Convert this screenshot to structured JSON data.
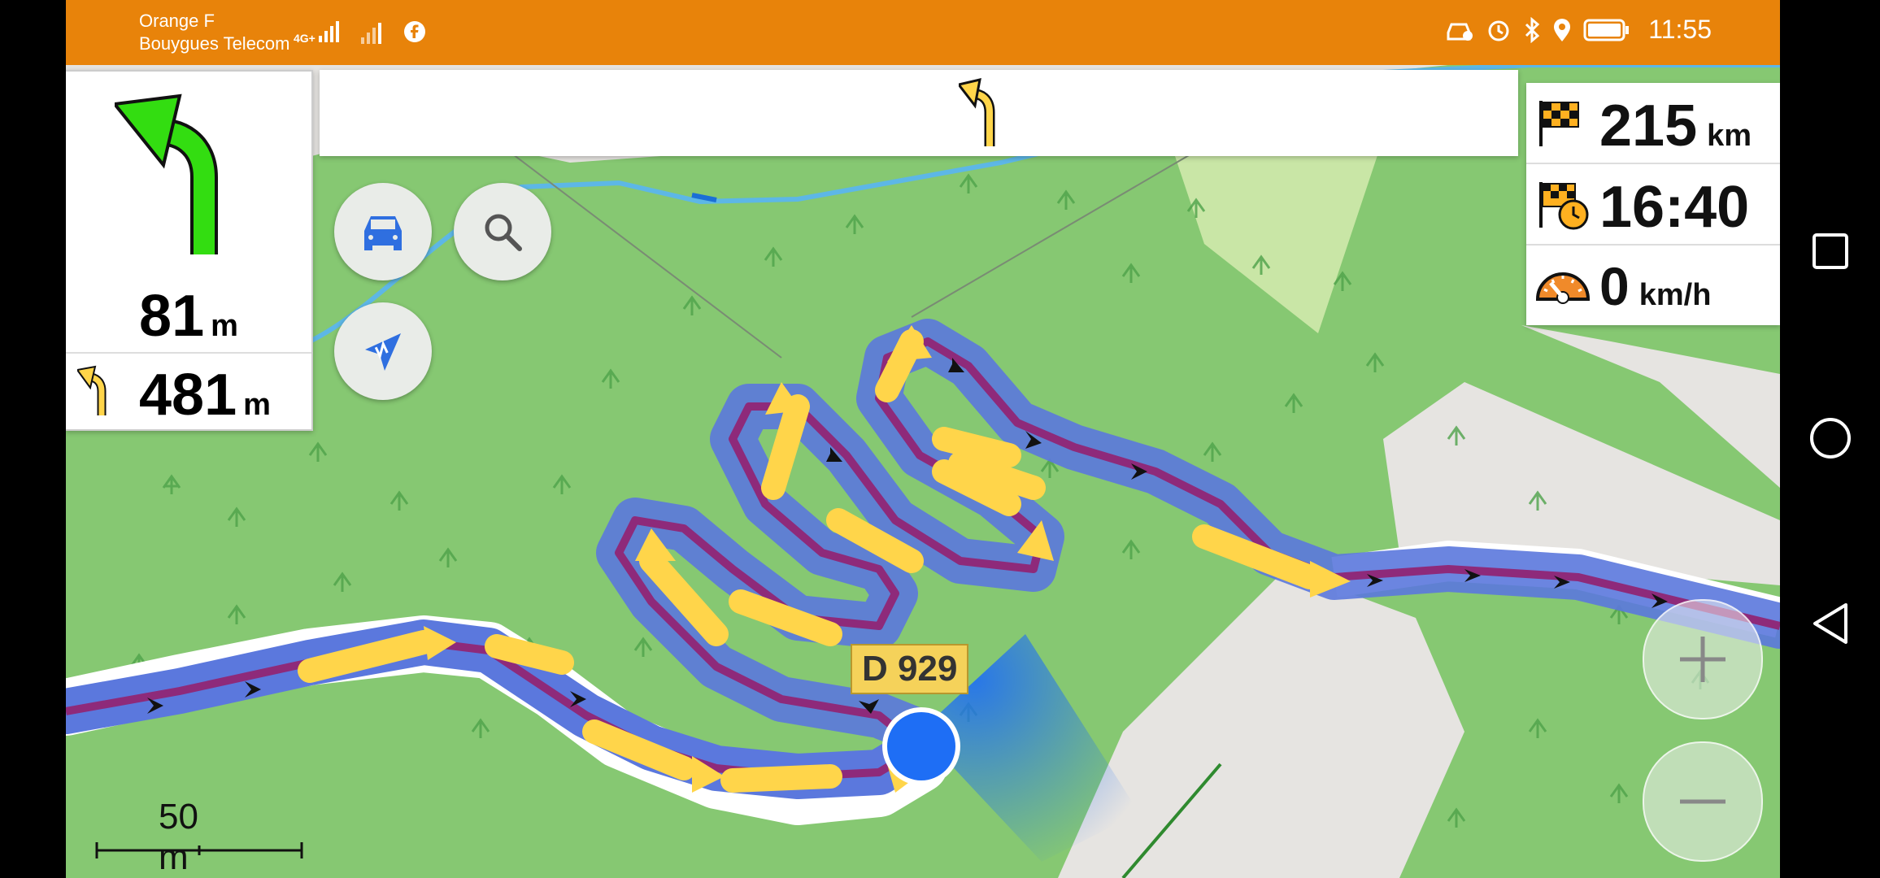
{
  "status_bar": {
    "carrier_1": "Orange F",
    "carrier_2": "Bouygues Telecom",
    "network": "4G+",
    "time": "11:55"
  },
  "maneuver": {
    "distance": "81",
    "distance_unit": "m",
    "next_distance": "481",
    "next_unit": "m"
  },
  "trip_info": {
    "remaining_distance": "215",
    "remaining_distance_unit": "km",
    "arrival_time": "16:40",
    "speed": "0",
    "speed_unit": "km/h"
  },
  "map": {
    "road_label": "D 929",
    "scale_label": "50 m"
  },
  "colors": {
    "status_bar": "#e8830a",
    "turn_arrow": "#33dd11",
    "route": "#5b78dd",
    "position": "#1e6ef5",
    "forest": "#86c872"
  },
  "icons": [
    "car-icon",
    "search-icon",
    "compass-icon",
    "zoom-in-icon",
    "zoom-out-icon",
    "finish-flag-icon",
    "arrival-clock-icon",
    "speedometer-icon"
  ]
}
